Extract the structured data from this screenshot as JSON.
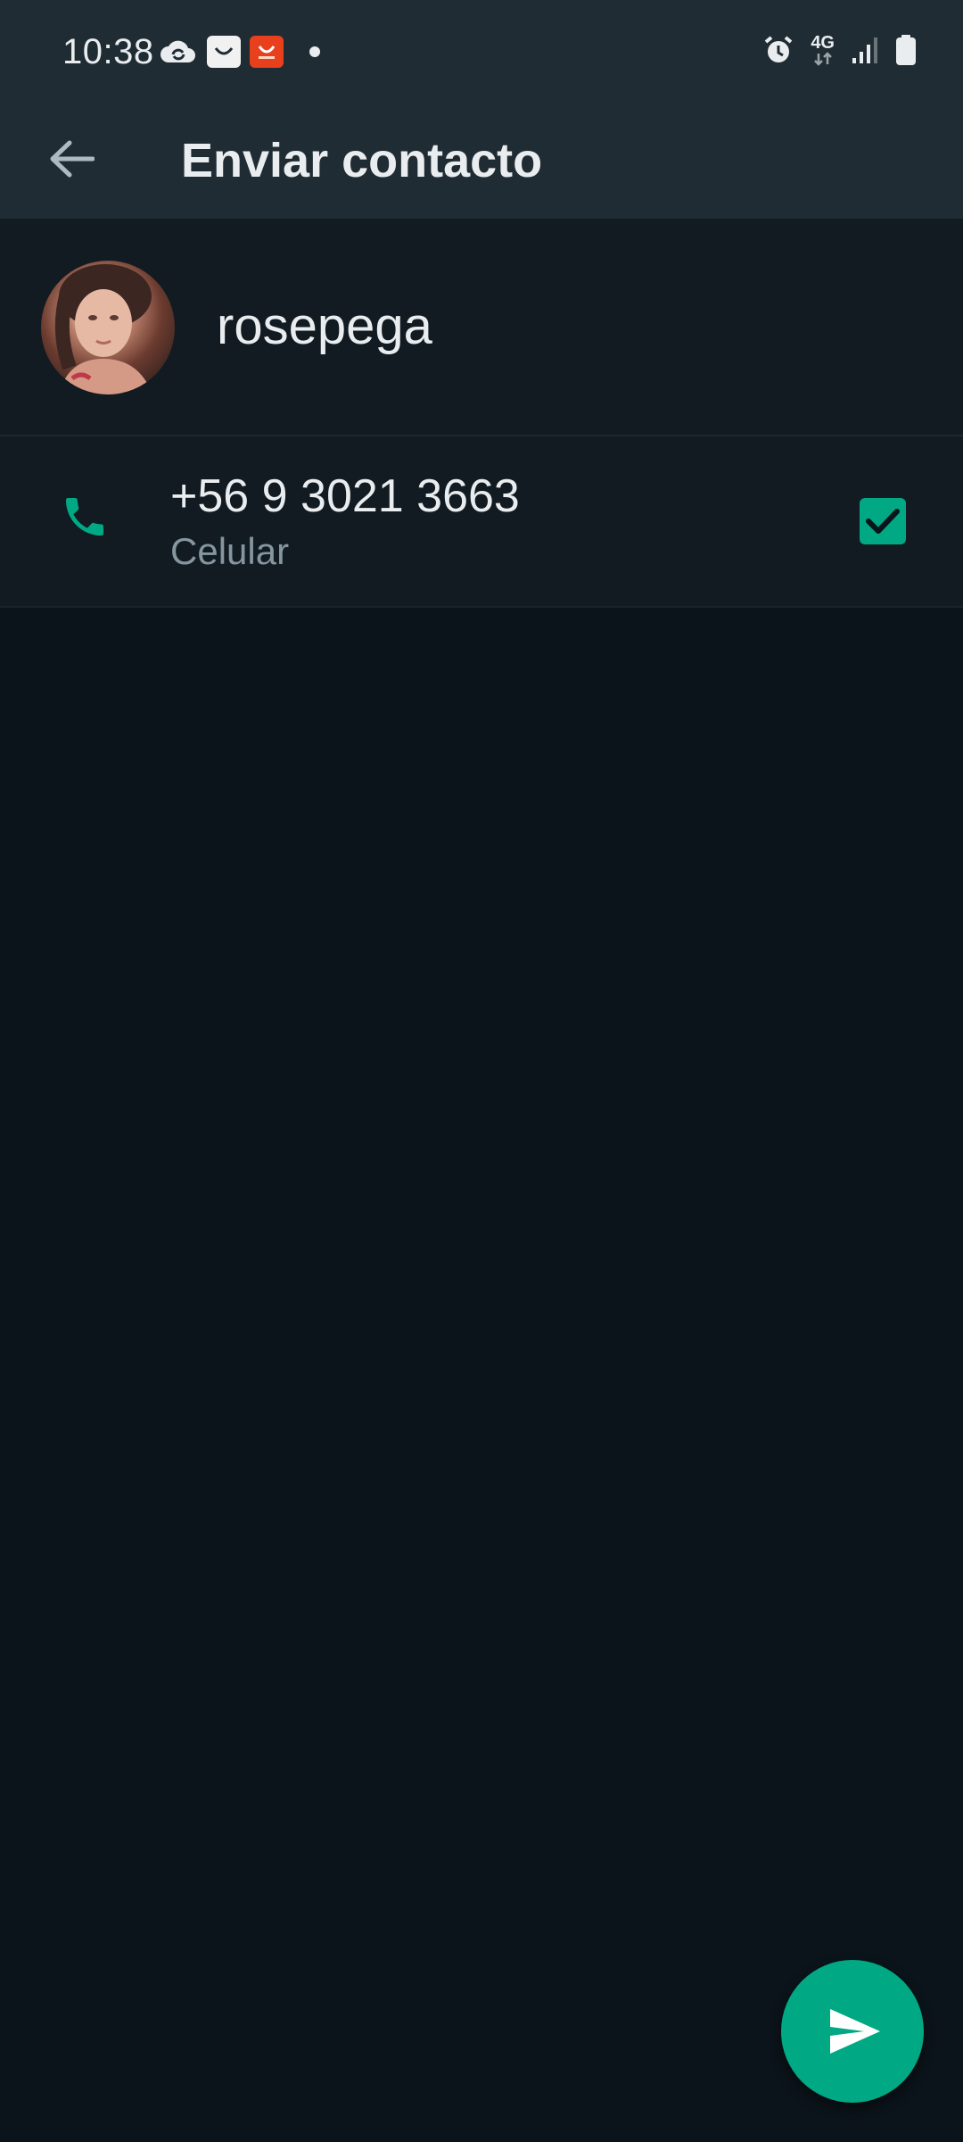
{
  "status_bar": {
    "time": "10:38",
    "network": "4G"
  },
  "app_bar": {
    "title": "Enviar contacto"
  },
  "contact": {
    "name": "rosepega"
  },
  "phone": {
    "number": "+56 9 3021 3663",
    "type": "Celular",
    "selected": true
  },
  "icons": {
    "back": "arrow-back-icon",
    "phone": "phone-icon",
    "send": "send-icon",
    "checkbox": "checkbox-checked-icon"
  },
  "colors": {
    "accent": "#00a884",
    "header_bg": "#202c33",
    "background": "#0b141a",
    "row_bg": "#111b21",
    "secondary_text": "#8696a0"
  }
}
